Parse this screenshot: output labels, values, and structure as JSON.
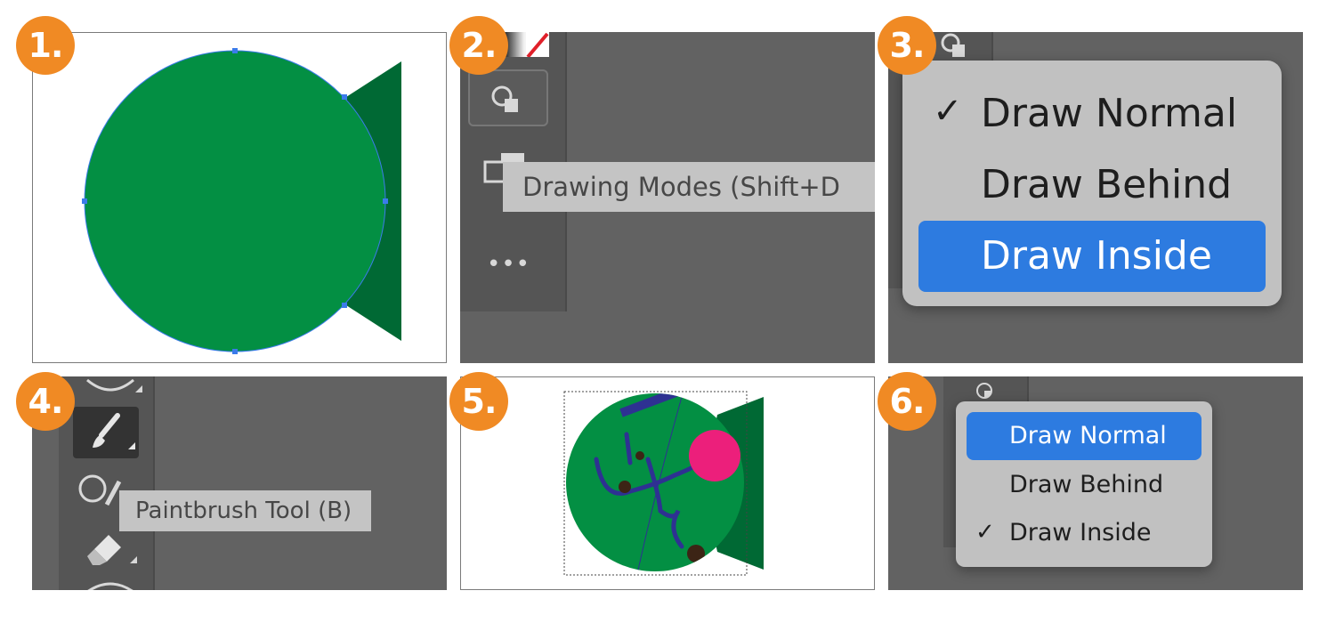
{
  "steps": {
    "s1": "1.",
    "s2": "2.",
    "s3": "3.",
    "s4": "4.",
    "s5": "5.",
    "s6": "6."
  },
  "panel2": {
    "tooltip": "Drawing Modes (Shift+D"
  },
  "panel3": {
    "menu": [
      {
        "label": "Draw Normal",
        "checked": true,
        "highlighted": false
      },
      {
        "label": "Draw Behind",
        "checked": false,
        "highlighted": false
      },
      {
        "label": "Draw Inside",
        "checked": false,
        "highlighted": true
      }
    ]
  },
  "panel4": {
    "tooltip": "Paintbrush Tool (B)"
  },
  "panel6": {
    "menu": [
      {
        "label": "Draw Normal",
        "checked": false,
        "highlighted": true
      },
      {
        "label": "Draw Behind",
        "checked": false,
        "highlighted": false
      },
      {
        "label": "Draw Inside",
        "checked": true,
        "highlighted": false
      }
    ]
  },
  "check_glyph": "✓",
  "more_glyph": "•••",
  "colors": {
    "badge": "#f08a24",
    "circle_green": "#038f43",
    "tail_green": "#006934",
    "selection_blue": "#2d7be0",
    "pink": "#ec1f7b",
    "stroke_blue": "#2e3192",
    "dot_brown": "#3c2415",
    "ui_dark": "#626262"
  }
}
